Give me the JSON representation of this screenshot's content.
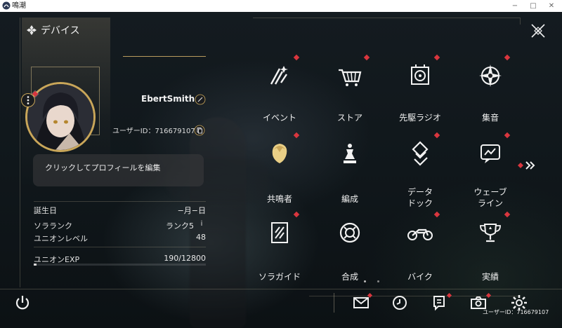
{
  "window": {
    "title": "鳴潮",
    "minimize": "−",
    "maximize": "□",
    "close": "✕"
  },
  "header": {
    "title": "デバイス",
    "icon": "diamond-cluster-icon"
  },
  "profile": {
    "username": "EbertSmith",
    "user_id_label": "ユーザーID：716679107",
    "edit_profile_text": "クリックしてプロフィールを編集"
  },
  "stats": {
    "birthday_label": "誕生日",
    "birthday_value": "−月−日",
    "sola_rank_label": "ソラランク",
    "sola_rank_value": "ランク5",
    "union_level_label": "ユニオンレベル",
    "union_level_value": "48",
    "union_exp_label": "ユニオンEXP",
    "union_exp_value": "190/12800",
    "union_exp_progress": 0.0148,
    "info_glyph": "i"
  },
  "menu": [
    {
      "label": "イベント",
      "icon": "event-icon"
    },
    {
      "label": "ストア",
      "icon": "cart-icon"
    },
    {
      "label": "先駆ラジオ",
      "icon": "radio-icon"
    },
    {
      "label": "集音",
      "icon": "compass-icon"
    },
    {
      "label": "共鳴者",
      "icon": "resonator-icon"
    },
    {
      "label": "編成",
      "icon": "chess-icon"
    },
    {
      "label": "データ\nドック",
      "icon": "data-dock-icon"
    },
    {
      "label": "ウェーブ\nライン",
      "icon": "waveline-icon"
    },
    {
      "label": "ソラガイド",
      "icon": "guide-icon"
    },
    {
      "label": "合成",
      "icon": "synthesis-icon"
    },
    {
      "label": "バイク",
      "icon": "bike-icon"
    },
    {
      "label": "実績",
      "icon": "trophy-icon"
    }
  ],
  "bottom": {
    "user_id_label": "ユーザーID：716679107"
  },
  "colors": {
    "accent_gold": "#c9a659",
    "notify_red": "#d9363e",
    "background": "#0f1418"
  }
}
